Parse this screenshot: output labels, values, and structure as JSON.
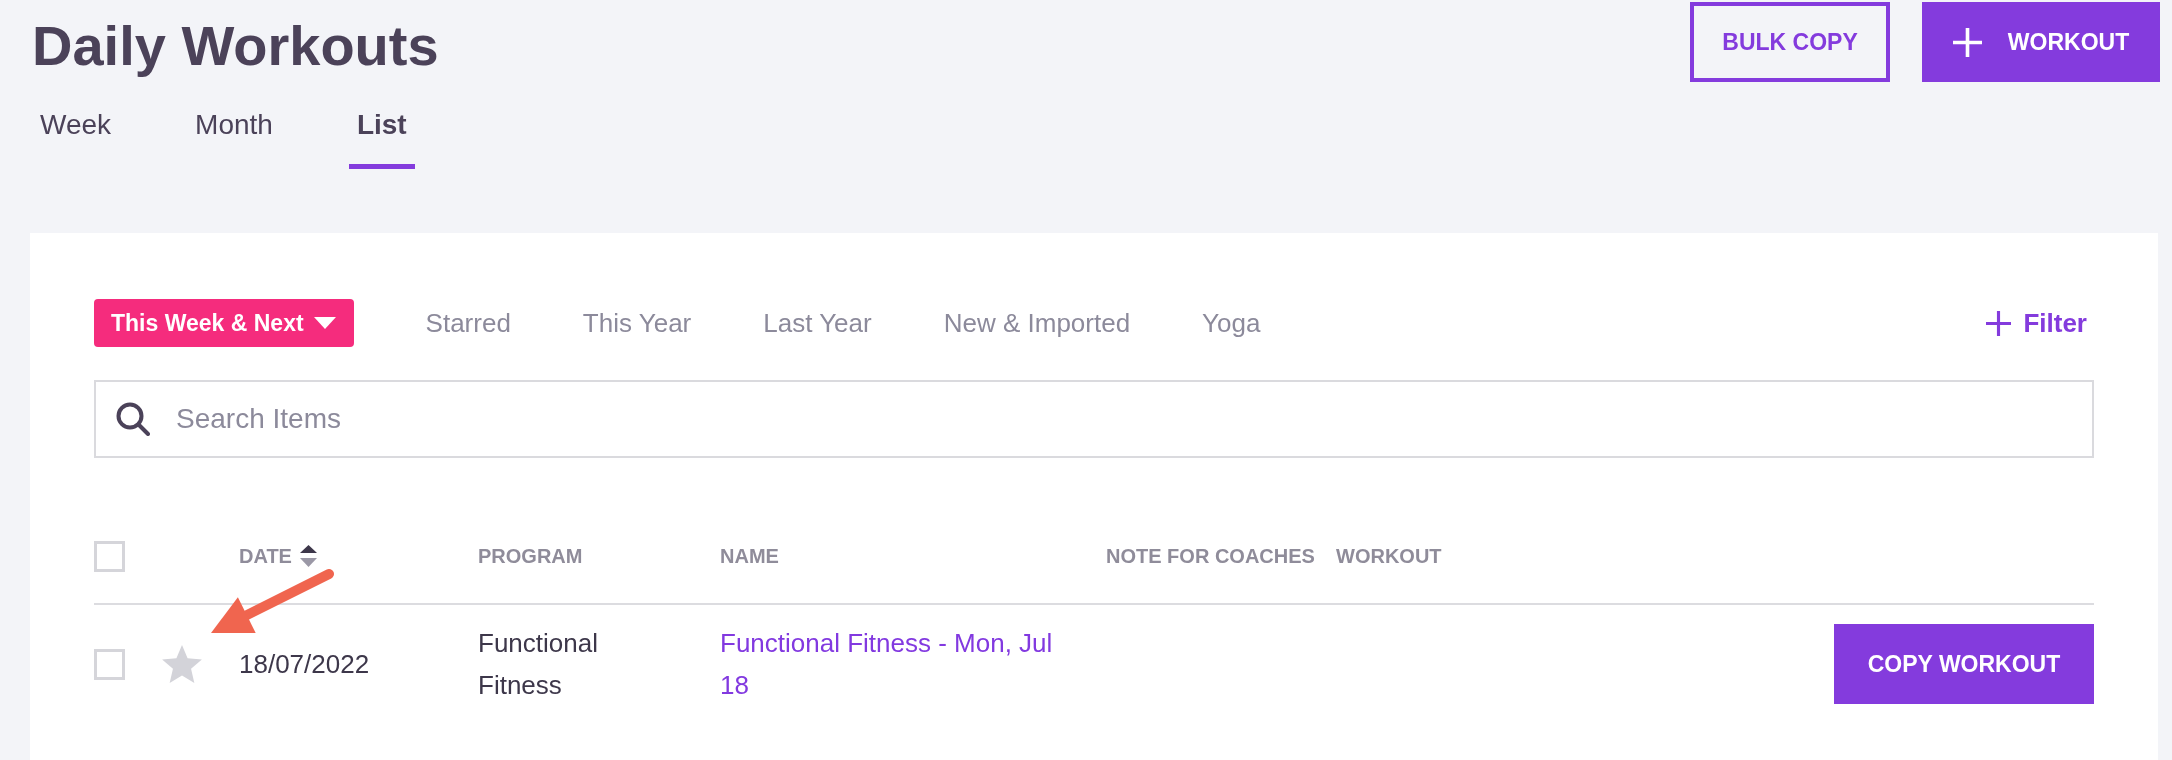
{
  "page": {
    "title": "Daily Workouts"
  },
  "actions": [
    {
      "kind": "outline",
      "label": "BULK COPY"
    },
    {
      "kind": "add",
      "label": "WORKOUT"
    }
  ],
  "view_tabs": [
    {
      "label": "Week",
      "selected": false
    },
    {
      "label": "Month",
      "selected": false
    },
    {
      "label": "List",
      "selected": true
    }
  ],
  "filters": {
    "presets": [
      {
        "label": "This Week & Next",
        "selected": true
      },
      {
        "label": "Starred",
        "selected": false
      },
      {
        "label": "This Year",
        "selected": false
      },
      {
        "label": "Last Year",
        "selected": false
      },
      {
        "label": "New & Imported",
        "selected": false
      },
      {
        "label": "Yoga",
        "selected": false
      }
    ],
    "add_filter": {
      "label": "Filter"
    }
  },
  "search": {
    "placeholder": "Search Items"
  },
  "table": {
    "select_all": {
      "checked": false
    },
    "columns": [
      {
        "label": "DATE",
        "sortable": true
      },
      {
        "label": "PROGRAM",
        "sortable": false
      },
      {
        "label": "NAME",
        "sortable": false
      },
      {
        "label": "NOTE FOR COACHES",
        "sortable": false
      },
      {
        "label": "WORKOUT",
        "sortable": false
      }
    ],
    "rows": [
      {
        "checked": false,
        "starred": false,
        "date": "18/07/2022",
        "program": "Functional Fitness",
        "name": "Functional Fitness - Mon, Jul 18",
        "action": "COPY WORKOUT"
      }
    ]
  }
}
